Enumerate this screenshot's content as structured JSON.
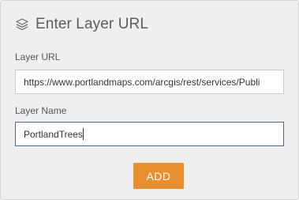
{
  "dialog": {
    "title": "Enter Layer URL",
    "icon": "layers-icon"
  },
  "layer_url": {
    "label": "Layer URL",
    "value": "https://www.portlandmaps.com/arcgis/rest/services/Publi"
  },
  "layer_name": {
    "label": "Layer Name",
    "value": "PortlandTrees"
  },
  "add_button": {
    "label": "ADD",
    "color": "#e98f2f"
  },
  "colors": {
    "panel_background": "#efefef",
    "focus_border": "#4c6d8a"
  }
}
